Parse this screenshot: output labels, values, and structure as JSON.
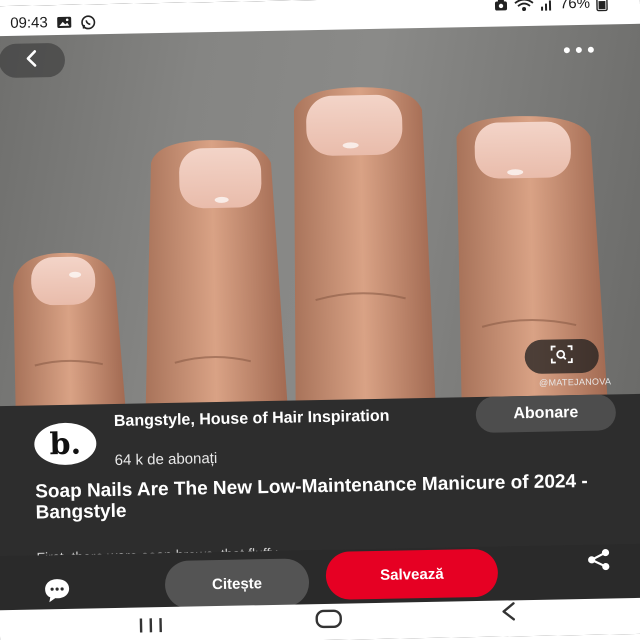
{
  "status_bar": {
    "time": "09:43",
    "battery_percent": "76%",
    "left_icons": [
      "image-notification-icon",
      "whatsapp-icon"
    ],
    "right_icons": [
      "sync-icon",
      "wifi-icon",
      "signal-icon",
      "battery-icon"
    ]
  },
  "hero": {
    "watermark": "@MATEJANOVA",
    "icons": [
      "back-arrow-icon",
      "more-dots-icon",
      "visual-search-icon"
    ]
  },
  "creator": {
    "avatar_letter": "b.",
    "name": "Bangstyle, House of Hair Inspiration",
    "followers": "64 k de abonați",
    "follow_label": "Abonare"
  },
  "pin": {
    "title": "Soap Nails Are The New Low-Maintenance Manicure of 2024 - Bangstyle",
    "description": "First, there were soap brows, that fluffy"
  },
  "actions": {
    "read_label": "Citește",
    "save_label": "Salvează",
    "save_color": "#e60023",
    "icons": [
      "comment-icon",
      "share-icon"
    ]
  },
  "nav": {
    "icons": [
      "recents-icon",
      "home-icon",
      "back-icon"
    ]
  }
}
